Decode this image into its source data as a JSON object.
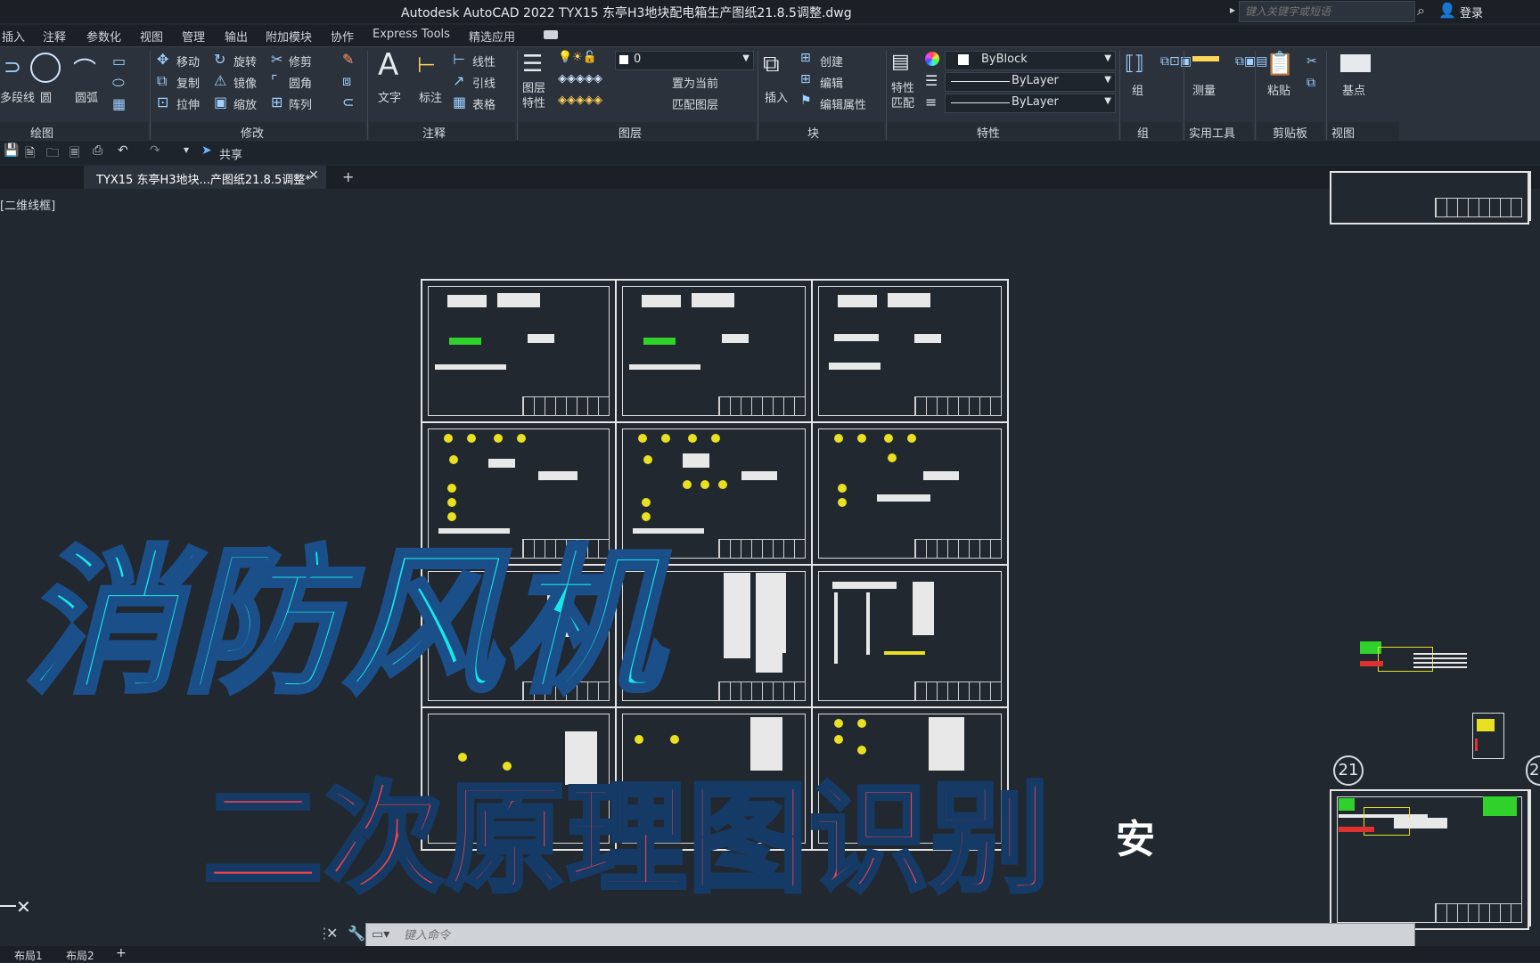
{
  "titlebar": {
    "title": "Autodesk AutoCAD 2022    TYX15 东亭H3地块配电箱生产图纸21.8.5调整.dwg",
    "search_placeholder": "键入关键字或短语",
    "login": "登录"
  },
  "menu": [
    "插入",
    "注释",
    "参数化",
    "视图",
    "管理",
    "输出",
    "附加模块",
    "协作",
    "Express Tools",
    "精选应用"
  ],
  "ribbon": {
    "draw": {
      "polyline": "多段线",
      "circle": "圆",
      "arc": "圆弧",
      "label": "绘图"
    },
    "modify": {
      "move": "移动",
      "rotate": "旋转",
      "trim": "修剪",
      "copy": "复制",
      "mirror": "镜像",
      "fillet": "圆角",
      "stretch": "拉伸",
      "scale": "缩放",
      "array": "阵列",
      "label": "修改"
    },
    "annotation": {
      "text": "文字",
      "dimension": "标注",
      "linear": "线性",
      "leader": "引线",
      "table": "表格",
      "label": "注释"
    },
    "layers": {
      "layer_props": "图层特性",
      "current_layer": "0",
      "set_current": "置为当前",
      "match_layer": "匹配图层",
      "label": "图层"
    },
    "block": {
      "insert": "插入",
      "create": "创建",
      "edit": "编辑",
      "edit_attr": "编辑属性",
      "label": "块"
    },
    "properties": {
      "match": "特性匹配",
      "color": "ByBlock",
      "linetype": "ByLayer",
      "lineweight": "ByLayer",
      "label": "特性"
    },
    "group": {
      "label": "组",
      "group": "组"
    },
    "utilities": {
      "measure": "测量",
      "label": "实用工具"
    },
    "clipboard": {
      "paste": "粘贴",
      "label": "剪贴板"
    },
    "view": {
      "base": "基点",
      "label": "视图"
    }
  },
  "qat": {
    "share": "共享"
  },
  "tabs": {
    "active": "TYX15 东亭H3地块...产图纸21.8.5调整*"
  },
  "viewport": {
    "label": "[二维线框]"
  },
  "overlay": {
    "line1": "消防风机",
    "line2": "二次原理图识别",
    "partial": "安"
  },
  "markers": {
    "m21": "21",
    "m2": "2"
  },
  "command": {
    "placeholder": "键入命令"
  },
  "layouts": [
    "布局1",
    "布局2"
  ]
}
